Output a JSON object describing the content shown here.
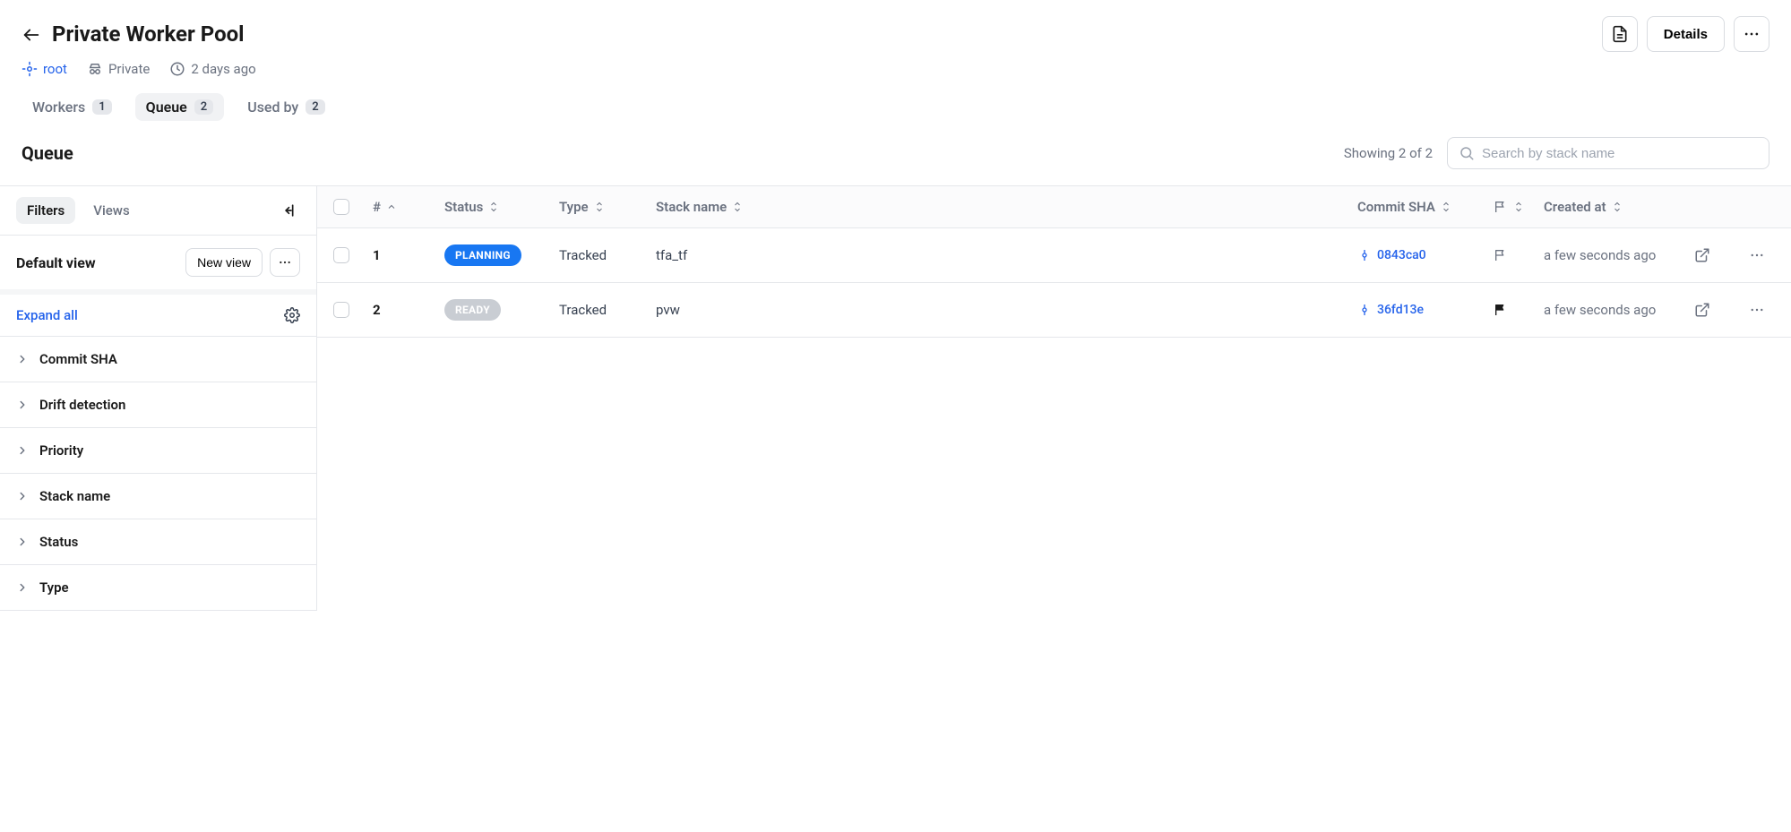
{
  "header": {
    "title": "Private Worker Pool",
    "details_label": "Details",
    "meta": {
      "root_label": "root",
      "visibility_label": "Private",
      "age_label": "2 days ago"
    },
    "tabs": [
      {
        "label": "Workers",
        "count": "1"
      },
      {
        "label": "Queue",
        "count": "2"
      },
      {
        "label": "Used by",
        "count": "2"
      }
    ]
  },
  "subheader": {
    "title": "Queue",
    "showing_text": "Showing 2 of 2",
    "search_placeholder": "Search by stack name"
  },
  "sidebar": {
    "tabs": {
      "filters": "Filters",
      "views": "Views"
    },
    "view_label": "Default view",
    "new_view_label": "New view",
    "expand_label": "Expand all",
    "filters": [
      "Commit SHA",
      "Drift detection",
      "Priority",
      "Stack name",
      "Status",
      "Type"
    ]
  },
  "table": {
    "columns": {
      "num": "#",
      "status": "Status",
      "type": "Type",
      "stack": "Stack name",
      "commit": "Commit SHA",
      "created": "Created at"
    },
    "rows": [
      {
        "num": "1",
        "status": "PLANNING",
        "status_class": "status-planning",
        "type": "Tracked",
        "stack": "tfa_tf",
        "commit": "0843ca0",
        "flagged": false,
        "created": "a few seconds ago"
      },
      {
        "num": "2",
        "status": "READY",
        "status_class": "status-ready",
        "type": "Tracked",
        "stack": "pvw",
        "commit": "36fd13e",
        "flagged": true,
        "created": "a few seconds ago"
      }
    ]
  }
}
